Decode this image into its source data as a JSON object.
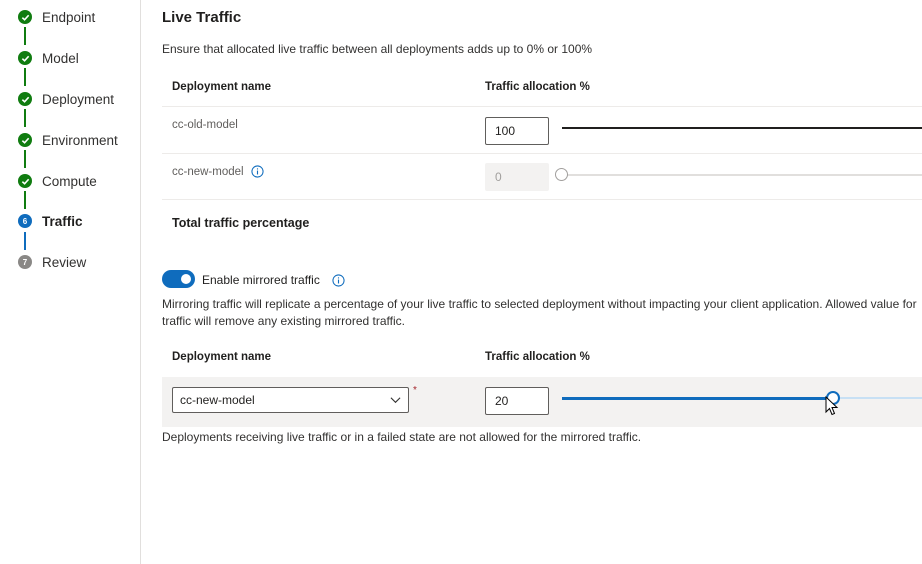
{
  "stepper": {
    "steps": [
      {
        "label": "Endpoint",
        "status": "done"
      },
      {
        "label": "Model",
        "status": "done"
      },
      {
        "label": "Deployment",
        "status": "done"
      },
      {
        "label": "Environment",
        "status": "done"
      },
      {
        "label": "Compute",
        "status": "done"
      },
      {
        "label": "Traffic",
        "status": "current",
        "number": "6"
      },
      {
        "label": "Review",
        "status": "pending",
        "number": "7"
      }
    ]
  },
  "live_traffic": {
    "title": "Live Traffic",
    "description": "Ensure that allocated live traffic between all deployments adds up to 0% or 100%",
    "columns": {
      "name": "Deployment name",
      "allocation": "Traffic allocation %"
    },
    "rows": [
      {
        "name": "cc-old-model",
        "value": "100",
        "slider_percent": 100,
        "disabled": false,
        "info_icon": false
      },
      {
        "name": "cc-new-model",
        "value": "0",
        "slider_percent": 0,
        "disabled": true,
        "info_icon": true
      }
    ],
    "total_label": "Total traffic percentage"
  },
  "mirrored": {
    "toggle_on": true,
    "toggle_label": "Enable mirrored traffic",
    "description_line1": "Mirroring traffic will replicate a percentage of your live traffic to selected deployment without impacting your client application. Allowed value for",
    "description_line2": "traffic will remove any existing mirrored traffic.",
    "columns": {
      "name": "Deployment name",
      "allocation": "Traffic allocation %"
    },
    "selected_deployment": "cc-new-model",
    "required_mark": "*",
    "value": "20",
    "slider_percent": 20,
    "footnote": "Deployments receiving live traffic or in a failed state are not allowed for the mirrored traffic."
  },
  "colors": {
    "done": "#107c10",
    "accent": "#0f6cbd",
    "pending": "#8a8886"
  }
}
